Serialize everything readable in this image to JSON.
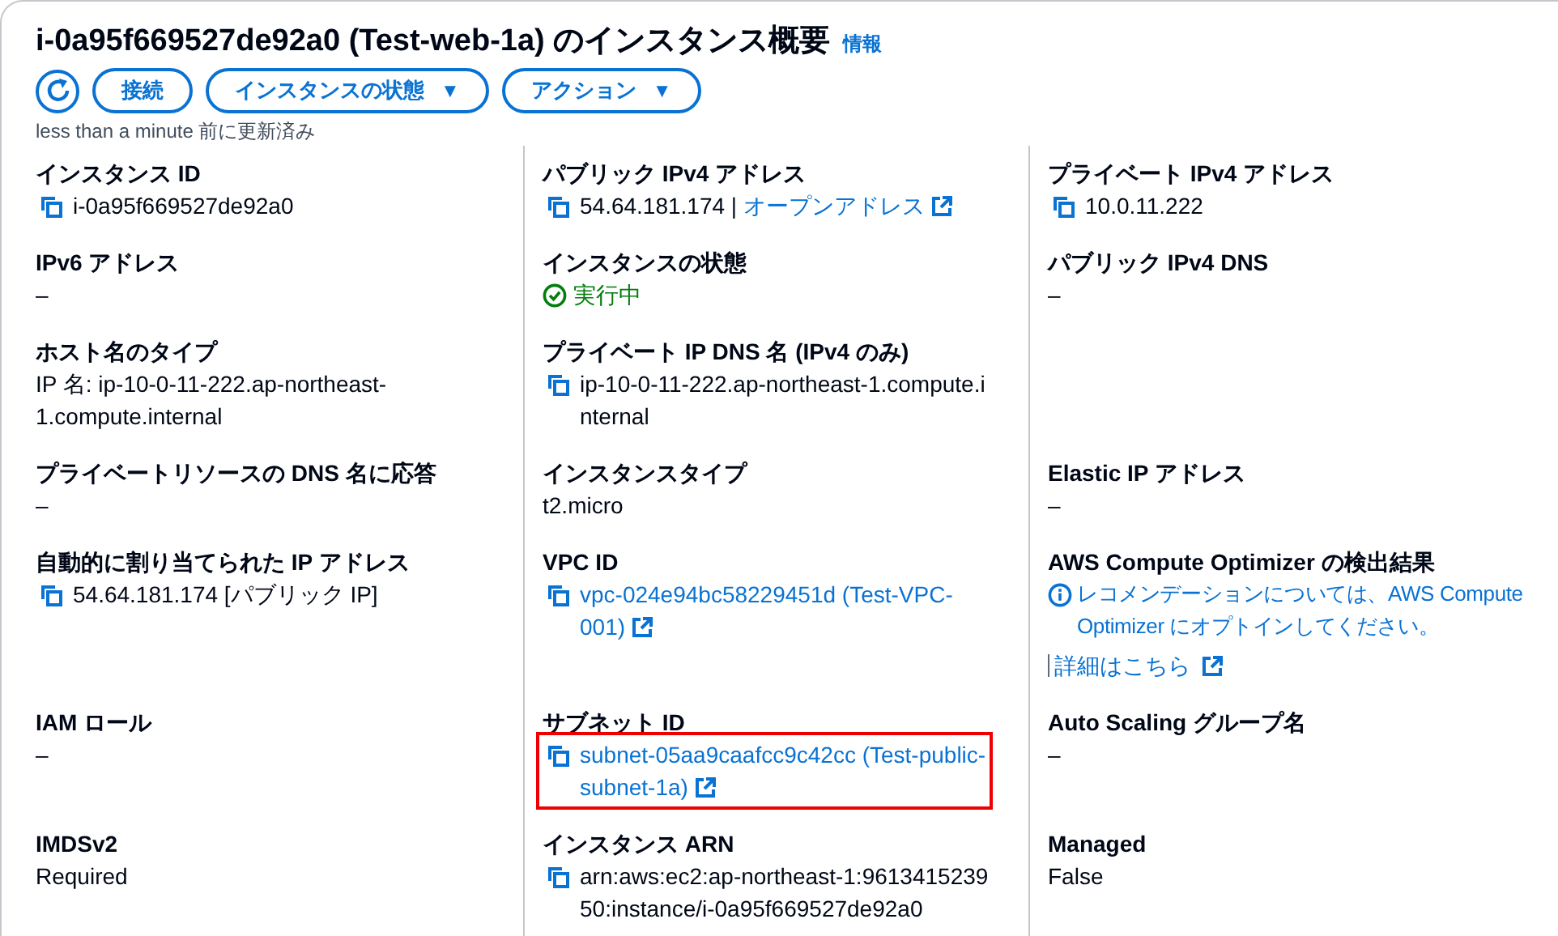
{
  "header": {
    "title": "i-0a95f669527de92a0 (Test-web-1a) のインスタンス概要",
    "info_link": "情報",
    "buttons": [
      {
        "kind": "refresh"
      },
      {
        "kind": "plain",
        "label": "接続"
      },
      {
        "kind": "dropdown",
        "label": "インスタンスの状態",
        "caret": "▼"
      },
      {
        "kind": "dropdown",
        "label": "アクション",
        "caret": "▼"
      }
    ],
    "updated": "less than a minute 前に更新済み"
  },
  "rows": [
    [
      {
        "label": "インスタンス ID",
        "kind": "copy",
        "value": "i-0a95f669527de92a0"
      },
      {
        "label": "パブリック IPv4 アドレス",
        "kind": "copy",
        "value": "54.64.181.174 |",
        "link": "オープンアドレス"
      },
      {
        "label": "プライベート IPv4 アドレス",
        "kind": "copy",
        "value": "10.0.11.222"
      }
    ],
    [
      {
        "label": "IPv6 アドレス",
        "kind": "text",
        "value": "–"
      },
      {
        "label": "インスタンスの状態",
        "kind": "status",
        "value": "実行中"
      },
      {
        "label": "パブリック IPv4 DNS",
        "kind": "text",
        "value": "–"
      }
    ],
    [
      {
        "label": "ホスト名のタイプ",
        "kind": "text",
        "value": "IP 名: ip-10-0-11-222.ap-northeast-1.compute.internal"
      },
      {
        "label": "プライベート IP DNS 名 (IPv4 のみ)",
        "kind": "copy",
        "value": "ip-10-0-11-222.ap-northeast-1.compute.internal"
      },
      {
        "kind": "empty"
      }
    ],
    [
      {
        "label": "プライベートリソースの DNS 名に応答",
        "kind": "text",
        "value": "–"
      },
      {
        "label": "インスタンスタイプ",
        "kind": "text",
        "value": "t2.micro"
      },
      {
        "label": "Elastic IP アドレス",
        "kind": "text",
        "value": "–"
      }
    ],
    [
      {
        "label": "自動的に割り当てられた IP アドレス",
        "kind": "copy",
        "value": "54.64.181.174 [パブリック IP]"
      },
      {
        "label": "VPC ID",
        "kind": "copy",
        "link": "vpc-024e94bc58229451d (Test-VPC-001)"
      },
      {
        "label": "AWS Compute Optimizer の検出結果",
        "kind": "notice",
        "value": "レコメンデーションについては、AWS Compute Optimizer にオプトインしてください。",
        "link": "詳細はこちら"
      }
    ],
    [
      {
        "label": "IAM ロール",
        "kind": "text",
        "value": "–"
      },
      {
        "label": "サブネット ID",
        "kind": "copy",
        "link": "subnet-05aa9caafcc9c42cc (Test-public-subnet-1a)",
        "highlighted": true
      },
      {
        "label": "Auto Scaling グループ名",
        "kind": "text",
        "value": "–"
      }
    ],
    [
      {
        "label": "IMDSv2",
        "kind": "text",
        "value": "Required"
      },
      {
        "label": "インスタンス ARN",
        "kind": "copy",
        "value": "arn:aws:ec2:ap-northeast-1:961341523950:instance/i-0a95f669527de92a0"
      },
      {
        "label": "Managed",
        "kind": "text",
        "value": "False"
      }
    ]
  ]
}
